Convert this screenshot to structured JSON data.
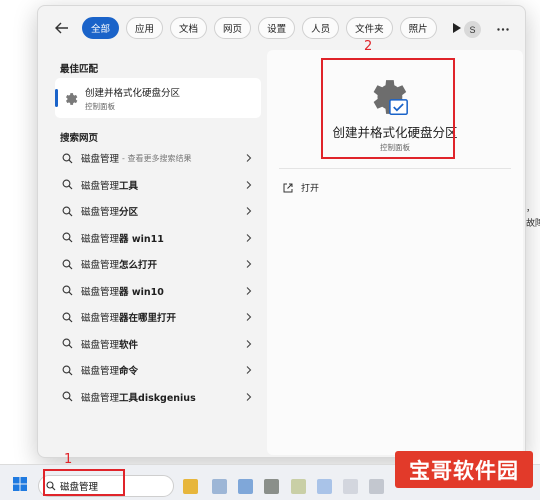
{
  "filters": {
    "chips": [
      "全部",
      "应用",
      "文档",
      "网页",
      "设置",
      "人员",
      "文件夹",
      "照片"
    ],
    "active_index": 0,
    "avatar_initial": "S"
  },
  "left": {
    "best_match_title": "最佳匹配",
    "best_match": {
      "title": "创建并格式化硬盘分区",
      "subtitle": "控制面板"
    },
    "web_title": "搜索网页",
    "results": [
      {
        "query": "磁盘管理",
        "bold": "",
        "hint": "- 查看更多搜索结果"
      },
      {
        "query": "磁盘管理",
        "bold": "工具",
        "hint": ""
      },
      {
        "query": "磁盘管理",
        "bold": "分区",
        "hint": ""
      },
      {
        "query": "磁盘管理",
        "bold": "器 win11",
        "hint": ""
      },
      {
        "query": "磁盘管理",
        "bold": "怎么打开",
        "hint": ""
      },
      {
        "query": "磁盘管理",
        "bold": "器 win10",
        "hint": ""
      },
      {
        "query": "磁盘管理",
        "bold": "器在哪里打开",
        "hint": ""
      },
      {
        "query": "磁盘管理",
        "bold": "软件",
        "hint": ""
      },
      {
        "query": "磁盘管理",
        "bold": "命令",
        "hint": ""
      },
      {
        "query": "磁盘管理",
        "bold": "工具diskgenius",
        "hint": ""
      }
    ]
  },
  "right": {
    "app_title": "创建并格式化硬盘分区",
    "app_subtitle": "控制面板",
    "open_label": "打开"
  },
  "annotations": {
    "num1": "1",
    "num2": "2"
  },
  "taskbar": {
    "search_value": "磁盘管理"
  },
  "watermark": "宝哥软件园",
  "bg_fragments": [
    "，",
    "故障"
  ],
  "colors": {
    "accent": "#1a63c9",
    "annotation_red": "#e0242a",
    "watermark_red": "#e23a2a"
  }
}
